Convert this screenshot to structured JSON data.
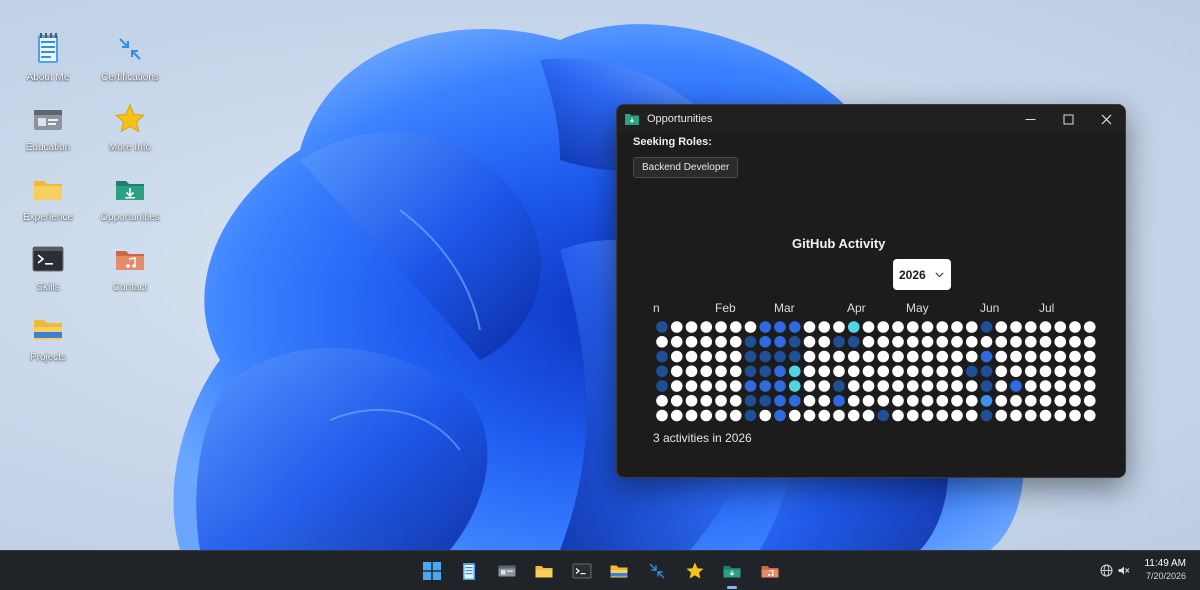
{
  "desktop": {
    "icons": [
      {
        "label": "About Me",
        "icon": "notepad-icon"
      },
      {
        "label": "Certifications",
        "icon": "compress-arrows-icon"
      },
      {
        "label": "Education",
        "icon": "id-card-icon"
      },
      {
        "label": "More Info",
        "icon": "star-icon"
      },
      {
        "label": "Experience",
        "icon": "folder-icon"
      },
      {
        "label": "Opportunities",
        "icon": "download-folder-icon"
      },
      {
        "label": "Skills",
        "icon": "terminal-icon"
      },
      {
        "label": "Contact",
        "icon": "music-folder-icon"
      },
      {
        "label": "Projects",
        "icon": "open-folder-icon"
      }
    ]
  },
  "window": {
    "title": "Opportunities",
    "controls": {
      "minimize": "—",
      "maximize": "☐",
      "close": "✕"
    },
    "seeking_label": "Seeking Roles:",
    "roles": [
      "Backend Developer"
    ],
    "github": {
      "heading": "GitHub Activity",
      "selected_year": "2026",
      "months": [
        "n",
        "Feb",
        "Mar",
        "Apr",
        "May",
        "Jun",
        "Jul"
      ],
      "summary": "3 activities in 2026",
      "levels": {
        "empty": "#ffffff",
        "level1": "#1f4f96",
        "level2": "#2f6ae0",
        "level3": "#3f8ff0",
        "level4": "#4fd6e3"
      }
    }
  },
  "taskbar": {
    "apps": [
      "start-icon",
      "notepad-icon",
      "id-card-icon",
      "folder-icon",
      "terminal-icon",
      "open-folder-icon",
      "compress-arrows-icon",
      "star-icon",
      "download-folder-icon",
      "music-folder-icon"
    ],
    "time": "11:49 AM",
    "date": "7/20/2026"
  },
  "colors": {
    "accent": "#2f6ae0",
    "window_bg": "#1c1c1c",
    "taskbar_bg": "#202327"
  }
}
